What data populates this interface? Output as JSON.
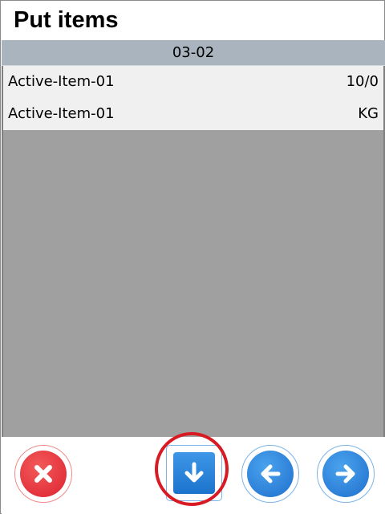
{
  "header": {
    "title": "Put items"
  },
  "location": {
    "code": "03-02"
  },
  "items": [
    {
      "name": "Active-Item-01",
      "value": "10/0"
    },
    {
      "name": "Active-Item-01",
      "value": "KG"
    }
  ],
  "toolbar": {
    "buttons": [
      {
        "icon": "close-icon",
        "color": "#e02a34"
      },
      {
        "icon": "arrow-down-icon",
        "color": "#2a84dc",
        "highlighted": true
      },
      {
        "icon": "arrow-left-icon",
        "color": "#2a84dc"
      },
      {
        "icon": "arrow-right-icon",
        "color": "#2a84dc"
      }
    ],
    "highlight_color": "#d81a23"
  }
}
